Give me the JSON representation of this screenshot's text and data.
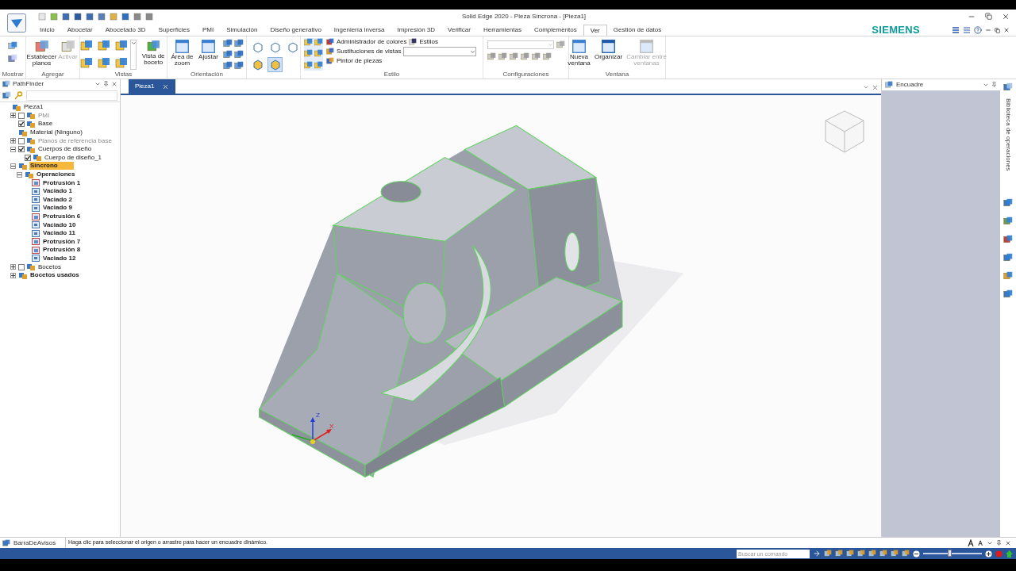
{
  "window": {
    "title": "Solid Edge 2020 - Pieza Síncrona - [Pieza1]"
  },
  "tabs": [
    {
      "label": "Inicio",
      "selected": false
    },
    {
      "label": "Abocetar",
      "selected": false
    },
    {
      "label": "Abocetado 3D",
      "selected": false
    },
    {
      "label": "Superficies",
      "selected": false
    },
    {
      "label": "PMI",
      "selected": false
    },
    {
      "label": "Simulación",
      "selected": false
    },
    {
      "label": "Diseño generativo",
      "selected": false
    },
    {
      "label": "Ingeniería inversa",
      "selected": false
    },
    {
      "label": "Impresión 3D",
      "selected": false
    },
    {
      "label": "Verificar",
      "selected": false
    },
    {
      "label": "Herramientas",
      "selected": false
    },
    {
      "label": "Complementos",
      "selected": false
    },
    {
      "label": "Ver",
      "selected": true
    },
    {
      "label": "Gestión de datos",
      "selected": false
    }
  ],
  "brand": "SIEMENS",
  "ribbon": {
    "groups": [
      {
        "label": "Mostrar"
      },
      {
        "label": "Agregar",
        "commands": [
          {
            "label": "Establecer planos",
            "disabled": false
          },
          {
            "label": "Activar",
            "disabled": true
          }
        ]
      },
      {
        "label": "Vistas",
        "commands": [
          {
            "label": "Vista de boceto",
            "disabled": false
          }
        ]
      },
      {
        "label": "Orientación",
        "commands": [
          {
            "label": "Área de zoom",
            "disabled": false
          },
          {
            "label": "Ajustar",
            "disabled": false
          }
        ]
      },
      {
        "display_modes": [
          {
            "selected": false
          },
          {
            "selected": false
          },
          {
            "selected": false
          },
          {
            "selected": false
          },
          {
            "selected": true
          }
        ]
      },
      {
        "label": "Estilo",
        "commands": [
          {
            "label": "Administrador de colores",
            "disabled": false
          },
          {
            "label": "Estilos",
            "disabled": false
          },
          {
            "label": "Sustituciones de vistas",
            "disabled": false
          },
          {
            "label": "Pintor de piezas",
            "disabled": false
          }
        ]
      },
      {
        "label": "Configuraciones"
      },
      {
        "label": "Ventana",
        "commands": [
          {
            "label": "Nueva ventana",
            "disabled": false
          },
          {
            "label": "Organizar",
            "disabled": false
          },
          {
            "label": "Cambiar entre ventanas",
            "disabled": true
          }
        ]
      }
    ]
  },
  "pathfinder": {
    "title": "PathFinder",
    "tree": [
      {
        "label": "Pieza1",
        "bold": false,
        "dimmed": false,
        "selected": false,
        "children": [
          {
            "label": "PMI",
            "expanded": false,
            "checked": false,
            "bold": false,
            "dimmed": true,
            "selected": false
          },
          {
            "label": "Base",
            "checked": true,
            "bold": false,
            "dimmed": false,
            "selected": false
          },
          {
            "label": "Material (Ninguno)",
            "bold": false,
            "dimmed": false,
            "selected": false
          },
          {
            "label": "Planos de referencia base",
            "expanded": false,
            "checked": false,
            "bold": false,
            "dimmed": true,
            "selected": false
          },
          {
            "label": "Cuerpos de diseño",
            "expanded": true,
            "checked": true,
            "bold": false,
            "dimmed": false,
            "selected": false,
            "children": [
              {
                "label": "Cuerpo de diseño_1",
                "checked": true,
                "bold": false,
                "dimmed": false,
                "selected": false
              }
            ]
          },
          {
            "label": "Síncrono",
            "expanded": true,
            "bold": true,
            "dimmed": false,
            "selected": true,
            "children": [
              {
                "label": "Operaciones",
                "expanded": true,
                "bold": true,
                "dimmed": false,
                "selected": false,
                "children": [
                  {
                    "label": "Protrusión 1",
                    "kind": "protrusion",
                    "bold": true,
                    "dimmed": false,
                    "selected": false
                  },
                  {
                    "label": "Vaciado 1",
                    "kind": "cutout",
                    "bold": true,
                    "dimmed": false,
                    "selected": false
                  },
                  {
                    "label": "Vaciado 2",
                    "kind": "cutout",
                    "bold": true,
                    "dimmed": false,
                    "selected": false
                  },
                  {
                    "label": "Vaciado 9",
                    "kind": "cutout",
                    "bold": true,
                    "dimmed": false,
                    "selected": false
                  },
                  {
                    "label": "Protrusión 6",
                    "kind": "protrusion",
                    "bold": true,
                    "dimmed": false,
                    "selected": false
                  },
                  {
                    "label": "Vaciado 10",
                    "kind": "cutout",
                    "bold": true,
                    "dimmed": false,
                    "selected": false
                  },
                  {
                    "label": "Vaciado 11",
                    "kind": "cutout",
                    "bold": true,
                    "dimmed": false,
                    "selected": false
                  },
                  {
                    "label": "Protrusión 7",
                    "kind": "protrusion",
                    "bold": true,
                    "dimmed": false,
                    "selected": false
                  },
                  {
                    "label": "Protrusión 8",
                    "kind": "protrusion",
                    "bold": true,
                    "dimmed": false,
                    "selected": false
                  },
                  {
                    "label": "Vaciado 12",
                    "kind": "cutout",
                    "bold": true,
                    "dimmed": false,
                    "selected": false
                  }
                ]
              }
            ]
          },
          {
            "label": "Bocetos",
            "expanded": false,
            "checked": false,
            "bold": false,
            "dimmed": false,
            "selected": false
          },
          {
            "label": "Bocetos usados",
            "expanded": false,
            "bold": true,
            "dimmed": false,
            "selected": false
          }
        ]
      }
    ]
  },
  "document_tab": {
    "label": "Pieza1"
  },
  "triad": {
    "axes": [
      "Z",
      "X"
    ]
  },
  "side_panel": {
    "title": "Encuadre"
  },
  "right_rail": {
    "label": "Biblioteca de operaciones"
  },
  "status": {
    "title": "BarraDeAvisos",
    "prompt": "Haga clic para seleccionar el origen o arrastre para hacer un encuadre dinámico."
  },
  "command_bar": {
    "search_placeholder": "Buscar un comando",
    "zoom": {
      "level": 0.45
    }
  }
}
